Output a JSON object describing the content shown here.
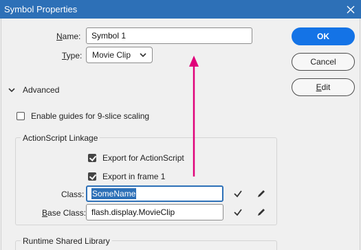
{
  "window": {
    "title": "Symbol Properties"
  },
  "name_field": {
    "label": "Name:",
    "value": "Symbol 1"
  },
  "type_field": {
    "label": "Type:",
    "value": "Movie Clip"
  },
  "buttons": {
    "ok": "OK",
    "cancel": "Cancel",
    "edit": "Edit"
  },
  "advanced": {
    "label": "Advanced"
  },
  "guides": {
    "label": "Enable guides for 9-slice scaling",
    "checked": false
  },
  "linkage": {
    "title": "ActionScript Linkage",
    "export_as": {
      "label": "Export for ActionScript",
      "checked": true
    },
    "export_frame": {
      "label": "Export in frame 1",
      "checked": true
    },
    "class_label": "Class:",
    "class_value": "SomeName",
    "base_label": "Base Class:",
    "base_value": "flash.display.MovieClip"
  },
  "runtime": {
    "title": "Runtime Shared Library"
  },
  "colors": {
    "accent": "#1473e6",
    "titlebar": "#2d70b7",
    "annotation_arrow": "#e0007a"
  }
}
